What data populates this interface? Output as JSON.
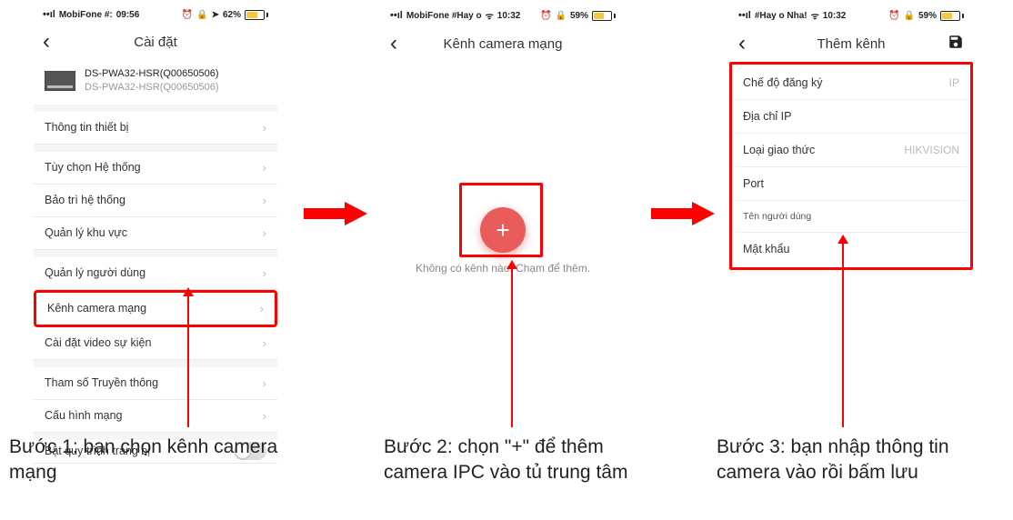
{
  "phone1": {
    "status": {
      "carrier": "MobiFone #:",
      "time": "09:56",
      "battery": "62%",
      "icons_left": "◂ ⌖",
      "icons_right": "⊙ ⌬ ◂"
    },
    "title": "Cài đặt",
    "device": {
      "line1": "DS-PWA32-HSR(Q00650506)",
      "line2": "DS-PWA32-HSR(Q00650506)"
    },
    "items": [
      "Thông tin thiết bị",
      "Tùy chọn Hệ thống",
      "Bảo trì hệ thống",
      "Quản lý khu vực",
      "Quản lý người dùng",
      "Kênh camera mạng",
      "Cài đặt video sự kiện",
      "Tham số Truyền thông",
      "Cấu hình mạng",
      "Bật quy trình trang bị"
    ]
  },
  "phone2": {
    "status": {
      "carrier": "MobiFone #Hay o",
      "time": "10:32",
      "battery": "59%"
    },
    "title": "Kênh camera mạng",
    "empty_text": "Không có kênh nào. Chạm để thêm.",
    "plus": "+"
  },
  "phone3": {
    "status": {
      "carrier": "#Hay o Nha!",
      "time": "10:32",
      "battery": "59%"
    },
    "title": "Thêm kênh",
    "fields": [
      {
        "label": "Chế độ đăng ký",
        "value": "IP"
      },
      {
        "label": "Địa chỉ IP",
        "value": ""
      },
      {
        "label": "Loại giao thức",
        "value": "HIKVISION"
      },
      {
        "label": "Port",
        "value": ""
      },
      {
        "label": "Tên người dùng",
        "value": "",
        "small": true
      },
      {
        "label": "Mật khẩu",
        "value": ""
      }
    ]
  },
  "captions": {
    "step1": "Bước 1: bạn chọn kênh camera mạng",
    "step2": "Bước 2: chọn \"+\" để thêm camera IPC vào tủ trung tâm",
    "step3": "Bước 3: bạn nhập thông tin camera vào rồi bấm lưu"
  }
}
